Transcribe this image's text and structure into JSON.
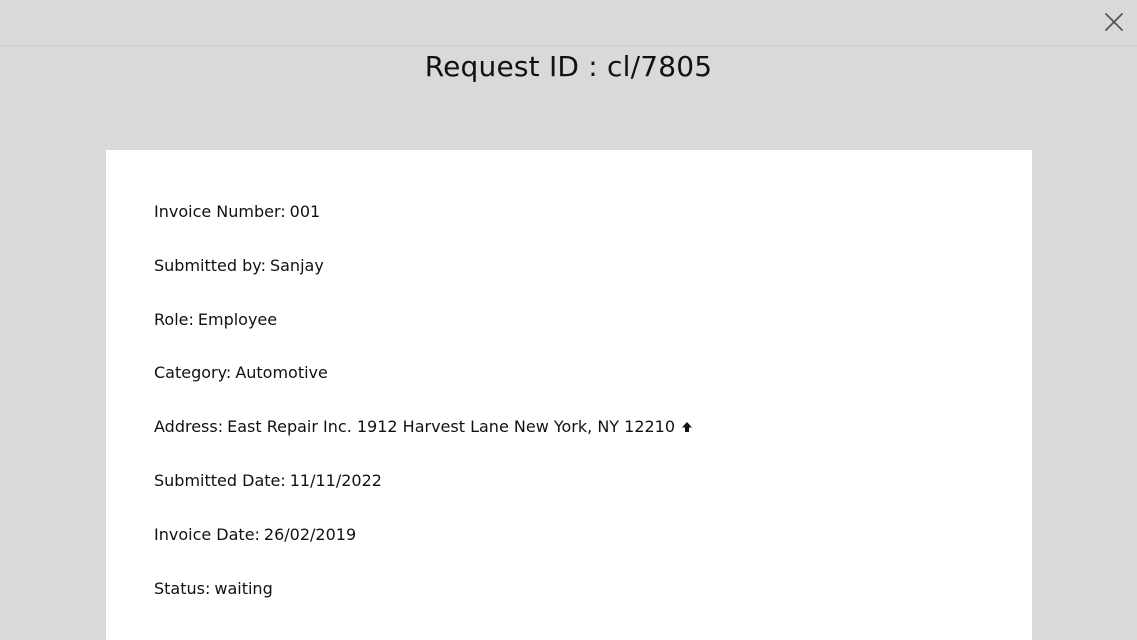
{
  "modal": {
    "title": "Request ID : cl/7805",
    "close_icon": "close-icon"
  },
  "details": {
    "invoice_number": {
      "label": "Invoice Number:",
      "value": "001"
    },
    "submitted_by": {
      "label": "Submitted by:",
      "value": "Sanjay"
    },
    "role": {
      "label": "Role:",
      "value": "Employee"
    },
    "category": {
      "label": "Category:",
      "value": "Automotive"
    },
    "address": {
      "label": "Address:",
      "value": "East Repair Inc. 1912 Harvest Lane New York, NY 12210",
      "icon": "arrow-up-icon"
    },
    "submitted_date": {
      "label": "Submitted Date:",
      "value": "11/11/2022"
    },
    "invoice_date": {
      "label": "Invoice Date:",
      "value": "26/02/2019"
    },
    "status": {
      "label": "Status:",
      "value": "waiting"
    }
  },
  "colors": {
    "backdrop": "#d9d9d9",
    "card": "#ffffff",
    "text": "#111111"
  }
}
